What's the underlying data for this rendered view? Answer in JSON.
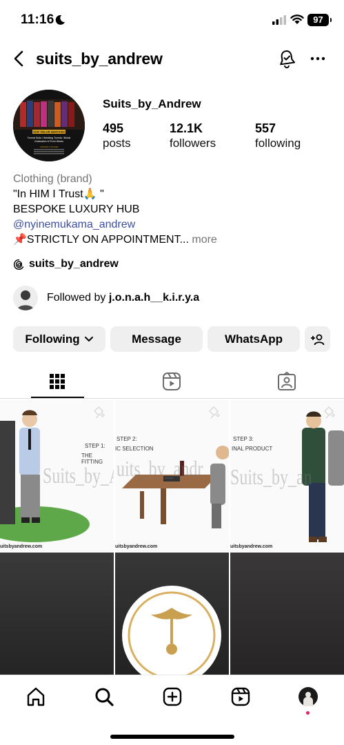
{
  "status_bar": {
    "time": "11:16",
    "battery": "97"
  },
  "header": {
    "username": "suits_by_andrew"
  },
  "profile": {
    "display_name": "Suits_by_Andrew",
    "stats": [
      {
        "value": "495",
        "label": "posts"
      },
      {
        "value": "12.1K",
        "label": "followers"
      },
      {
        "value": "557",
        "label": "following"
      }
    ],
    "bio": {
      "category": "Clothing (brand)",
      "line1": "\"In HIM I Trust🙏 \"",
      "line2": "BESPOKE LUXURY HUB",
      "mention": "@nyinemukama_andrew",
      "line3": "📌STRICTLY ON APPOINTMENT...",
      "more": "more"
    },
    "threads_handle": "suits_by_andrew",
    "followed_by_prefix": "Followed by",
    "followed_by_user": "j.o.n.a.h__k.i.r.y.a"
  },
  "actions": {
    "following": "Following",
    "message": "Message",
    "whatsapp": "WhatsApp"
  },
  "avatar_text": {
    "label": "OUR TAILOR SERVICES",
    "line1": "Formal Suits / Wedding Tuxedo / Bridal",
    "line2": "Graduation & Prom Wears",
    "contact": "CONTACT US FOR"
  },
  "posts": [
    {
      "step": "STEP 1:",
      "heading": "THE FITTING",
      "site": "uitsbyandrew.com",
      "watermark": "Suits_by_And"
    },
    {
      "step": "STEP 2:",
      "heading": "IC SELECTION",
      "site": "uitsbyandrew.com",
      "watermark": "uits_by_andr"
    },
    {
      "step": "STEP 3:",
      "heading": "INAL PRODUCT",
      "site": "uitsbyandrew.com",
      "watermark": "Suits_by_an"
    }
  ],
  "colors": {
    "mention": "#3d4f9f",
    "button_bg": "#efefef",
    "notification_dot": "#e0245e"
  }
}
